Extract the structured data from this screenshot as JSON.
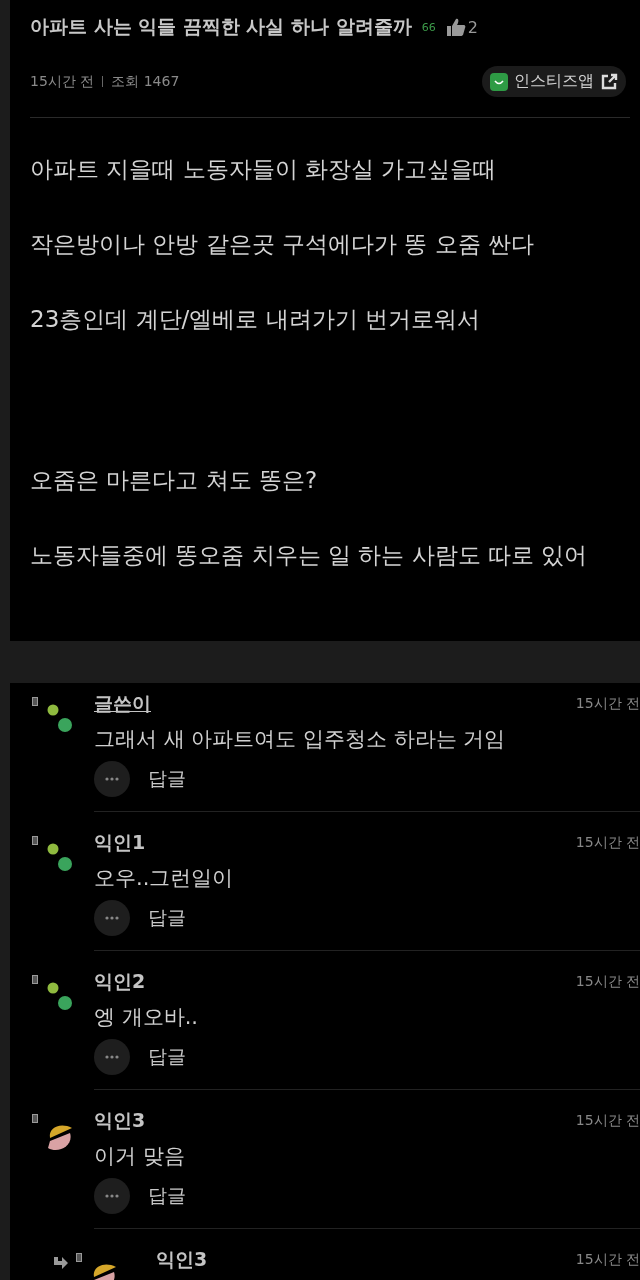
{
  "post": {
    "title": "아파트 사는 익들 끔찍한 사실 하나 알려줄까",
    "comment_count": "66",
    "likes": "2",
    "time": "15시간 전",
    "views": "조회 1467",
    "app_link": "인스티즈앱",
    "sections": [
      [
        "아파트 지을때 노동자들이 화장실 가고싶을때",
        "작은방이나 안방 같은곳 구석에다가 똥 오줌 싼다",
        "23층인데 계단/엘베로 내려가기 번거로워서"
      ],
      [
        "오줌은 마른다고 쳐도 똥은?",
        "노동자들중에 똥오줌 치우는 일 하는 사람도 따로 있어"
      ]
    ]
  },
  "comments": [
    {
      "author": "글쓴이",
      "is_author": true,
      "reply": false,
      "avatar": {
        "kind": "dots"
      },
      "time": "15시간 전",
      "text": "그래서 새 아파트여도 입주청소 하라는 거임",
      "reply_label": "답글"
    },
    {
      "author": "익인1",
      "is_author": false,
      "reply": false,
      "avatar": {
        "kind": "dots"
      },
      "time": "15시간 전",
      "text": "오우..그런일이",
      "reply_label": "답글"
    },
    {
      "author": "익인2",
      "is_author": false,
      "reply": false,
      "avatar": {
        "kind": "dots"
      },
      "time": "15시간 전",
      "text": "엥 개오바..",
      "reply_label": "답글"
    },
    {
      "author": "익인3",
      "is_author": false,
      "reply": false,
      "avatar": {
        "kind": "halves"
      },
      "time": "15시간 전",
      "text": "이거 맞음",
      "reply_label": "답글"
    },
    {
      "author": "익인3",
      "is_author": false,
      "reply": true,
      "avatar": {
        "kind": "halves"
      },
      "time": "15시간 전"
    }
  ]
}
